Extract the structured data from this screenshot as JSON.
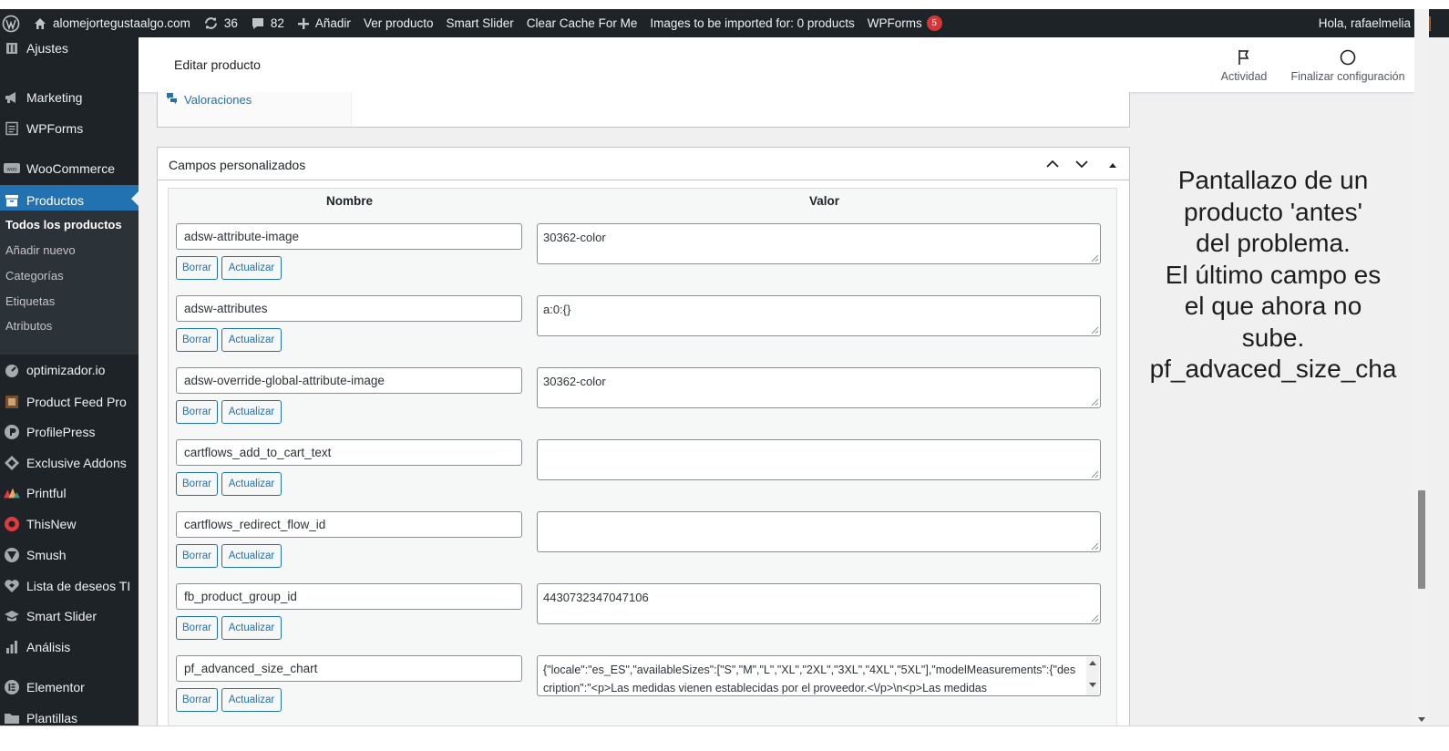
{
  "adminbar": {
    "site_name": "alomejortegustaalgo.com",
    "updates_count": "36",
    "comments_count": "82",
    "new_label": "Añadir",
    "view_product": "Ver producto",
    "smart_slider": "Smart Slider",
    "clear_cache": "Clear Cache For Me",
    "images_import": "Images to be imported for: 0 products",
    "wpforms": "WPForms",
    "wpforms_badge": "5",
    "greeting": "Hola, rafaelmelia"
  },
  "sidebar": {
    "items": [
      {
        "label": "Ajustes",
        "icon": "settings-icon"
      },
      {
        "label": "Marketing",
        "icon": "megaphone-icon"
      },
      {
        "label": "WPForms",
        "icon": "forms-icon"
      },
      {
        "label": "WooCommerce",
        "icon": "woo-icon"
      },
      {
        "label": "Productos",
        "icon": "archive-icon"
      },
      {
        "label": "optimizador.io",
        "icon": "gauge-icon"
      },
      {
        "label": "Product Feed Pro",
        "icon": "feed-icon"
      },
      {
        "label": "ProfilePress",
        "icon": "profile-icon"
      },
      {
        "label": "Exclusive Addons",
        "icon": "addons-icon"
      },
      {
        "label": "Printful",
        "icon": "printful-icon"
      },
      {
        "label": "ThisNew",
        "icon": "thisnew-icon"
      },
      {
        "label": "Smush",
        "icon": "smush-icon"
      },
      {
        "label": "Lista de deseos TI",
        "icon": "heart-icon"
      },
      {
        "label": "Smart Slider",
        "icon": "slider-icon"
      },
      {
        "label": "Análisis",
        "icon": "bar-chart-icon"
      },
      {
        "label": "Elementor",
        "icon": "elementor-icon"
      },
      {
        "label": "Plantillas",
        "icon": "folder-icon"
      }
    ],
    "submenu": [
      "Todos los productos",
      "Añadir nuevo",
      "Categorías",
      "Etiquetas",
      "Atributos"
    ]
  },
  "topbar": {
    "title": "Editar producto",
    "activity": "Actividad",
    "finish_setup": "Finalizar configuración"
  },
  "prev_box": {
    "tab_label": "Valoraciones"
  },
  "custom_fields": {
    "title": "Campos personalizados",
    "col_name": "Nombre",
    "col_value": "Valor",
    "delete_label": "Borrar",
    "update_label": "Actualizar",
    "rows": [
      {
        "key": "adsw-attribute-image",
        "value": "30362-color"
      },
      {
        "key": "adsw-attributes",
        "value": "a:0:{}"
      },
      {
        "key": "adsw-override-global-attribute-image",
        "value": "30362-color"
      },
      {
        "key": "cartflows_add_to_cart_text",
        "value": ""
      },
      {
        "key": "cartflows_redirect_flow_id",
        "value": ""
      },
      {
        "key": "fb_product_group_id",
        "value": "4430732347047106"
      },
      {
        "key": "pf_advanced_size_chart",
        "value": "{\"locale\":\"es_ES\",\"availableSizes\":[\"S\",\"M\",\"L\",\"XL\",\"2XL\",\"3XL\",\"4XL\",\"5XL\"],\"modelMeasurements\":{\"description\":\"<p>Las medidas vienen establecidas por el proveedor.<\\/p>\\n<p>Las medidas"
      }
    ]
  },
  "note": {
    "lines": [
      "Pantallazo de un",
      "producto 'antes'",
      "del problema.",
      "El último campo es",
      "el que ahora no",
      "sube.",
      "pf_advaced_size_cha"
    ]
  }
}
